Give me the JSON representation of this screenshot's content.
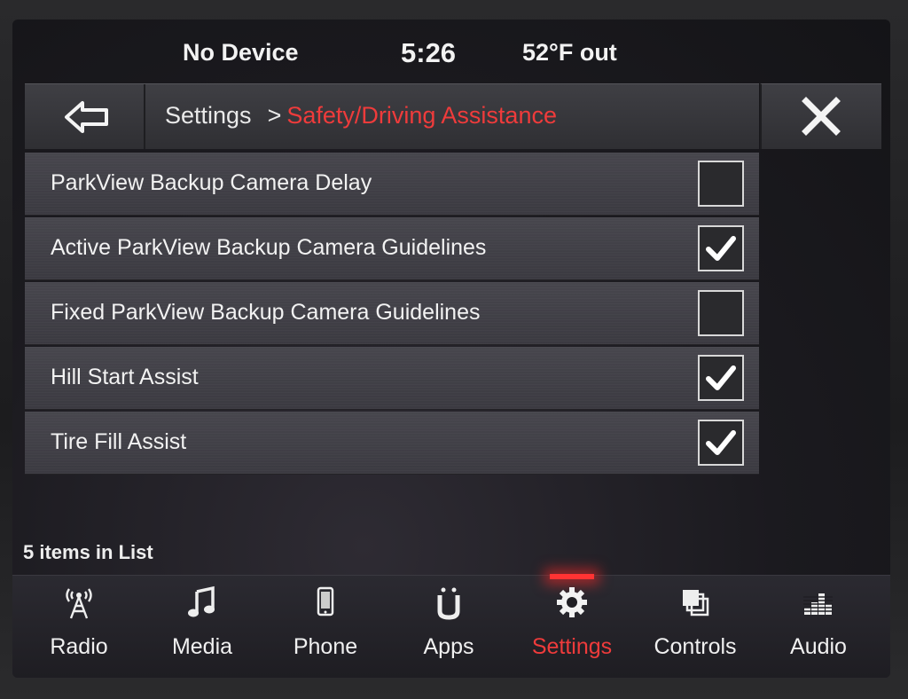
{
  "status": {
    "device": "No Device",
    "time": "5:26",
    "temperature": "52°F out"
  },
  "header": {
    "breadcrumb_root": "Settings",
    "separator": ">",
    "breadcrumb_current": "Safety/Driving Assistance",
    "accent_color": "#ef3b3b"
  },
  "list": {
    "items": [
      {
        "label": "ParkView Backup Camera Delay",
        "checked": false
      },
      {
        "label": "Active ParkView Backup Camera Guidelines",
        "checked": true
      },
      {
        "label": "Fixed ParkView Backup Camera Guidelines",
        "checked": false
      },
      {
        "label": "Hill Start Assist",
        "checked": true
      },
      {
        "label": "Tire Fill Assist",
        "checked": true
      }
    ],
    "count_text": "5 items in List"
  },
  "nav": {
    "items": [
      {
        "label": "Radio",
        "icon": "radio-tower-icon",
        "active": false
      },
      {
        "label": "Media",
        "icon": "music-note-icon",
        "active": false
      },
      {
        "label": "Phone",
        "icon": "phone-icon",
        "active": false
      },
      {
        "label": "Apps",
        "icon": "apps-icon",
        "active": false
      },
      {
        "label": "Settings",
        "icon": "gear-icon",
        "active": true
      },
      {
        "label": "Controls",
        "icon": "controls-icon",
        "active": false
      },
      {
        "label": "Audio",
        "icon": "equalizer-icon",
        "active": false
      }
    ]
  }
}
